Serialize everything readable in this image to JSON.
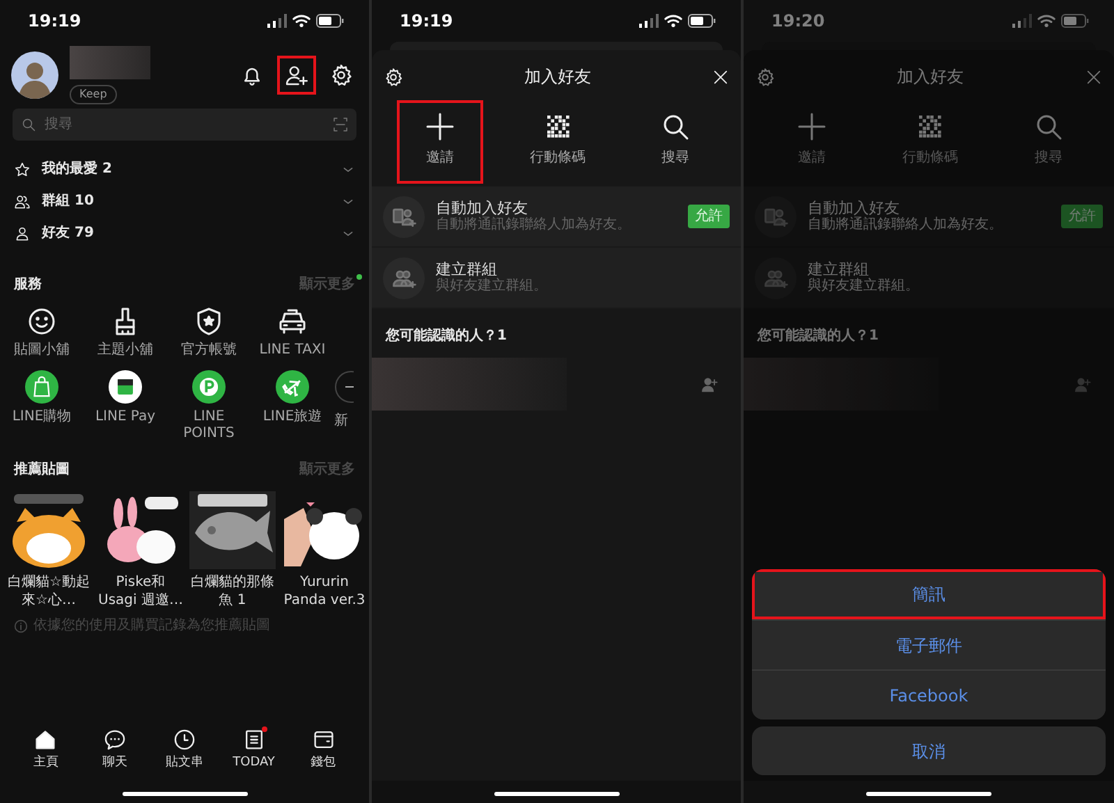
{
  "panels": [
    {
      "kind": "home",
      "status_time": "19:19",
      "profile": {
        "keep_label": "Keep"
      },
      "header_buttons": [
        {
          "highlighted": false
        },
        {
          "highlighted": true
        },
        {
          "highlighted": false
        }
      ],
      "search": {
        "placeholder": "搜尋"
      },
      "groups": [
        {
          "label": "我的最愛 2"
        },
        {
          "label": "群組 10"
        },
        {
          "label": "好友 79"
        }
      ],
      "services": {
        "title": "服務",
        "more": "顯示更多",
        "new_dot": true,
        "items": [
          {
            "label": "貼圖小舖",
            "kind": "outline"
          },
          {
            "label": "主題小舖",
            "kind": "outline"
          },
          {
            "label": "官方帳號",
            "kind": "outline"
          },
          {
            "label": "LINE TAXI",
            "kind": "outline"
          },
          {
            "label": "LINE購物",
            "kind": "green"
          },
          {
            "label": "LINE Pay",
            "kind": "white"
          },
          {
            "label": "LINE POINTS",
            "kind": "green"
          },
          {
            "label": "LINE旅遊",
            "kind": "green"
          },
          {
            "label": "新",
            "kind": "cut"
          }
        ]
      },
      "stickers": {
        "title": "推薦貼圖",
        "more": "顯示更多",
        "items": [
          {
            "name": "白爛貓☆動起來☆心…"
          },
          {
            "name": "Piske和 Usagi 週邀…"
          },
          {
            "name": "白爛貓的那條魚 1"
          },
          {
            "name": "Yururin Panda ver.3"
          }
        ],
        "note": "依據您的使用及購買記錄為您推薦貼圖"
      },
      "tabs": [
        {
          "label": "主頁",
          "selected": true,
          "badge": false
        },
        {
          "label": "聊天",
          "selected": false,
          "badge": false
        },
        {
          "label": "貼文串",
          "selected": false,
          "badge": false
        },
        {
          "label": "TODAY",
          "selected": false,
          "badge": true
        },
        {
          "label": "錢包",
          "selected": false,
          "badge": false
        }
      ]
    },
    {
      "kind": "add_friend",
      "dimmed": false,
      "status_time": "19:19",
      "title": "加入好友",
      "actions": [
        {
          "label": "邀請",
          "highlighted": true
        },
        {
          "label": "行動條碼",
          "highlighted": false
        },
        {
          "label": "搜尋",
          "highlighted": false
        }
      ],
      "rows": [
        {
          "title": "自動加入好友",
          "subtitle": "自動將通訊錄聯絡人加為好友。",
          "button": "允許"
        },
        {
          "title": "建立群組",
          "subtitle": "與好友建立群組。"
        }
      ],
      "section": "您可能認識的人？1"
    },
    {
      "kind": "add_friend",
      "dimmed": true,
      "status_time": "19:20",
      "title": "加入好友",
      "actions": [
        {
          "label": "邀請",
          "highlighted": false
        },
        {
          "label": "行動條碼",
          "highlighted": false
        },
        {
          "label": "搜尋",
          "highlighted": false
        }
      ],
      "rows": [
        {
          "title": "自動加入好友",
          "subtitle": "自動將通訊錄聯絡人加為好友。",
          "button": "允許"
        },
        {
          "title": "建立群組",
          "subtitle": "與好友建立群組。"
        }
      ],
      "section": "您可能認識的人？1",
      "action_sheet": {
        "options": [
          {
            "label": "簡訊",
            "highlighted": true
          },
          {
            "label": "電子郵件",
            "highlighted": false
          },
          {
            "label": "Facebook",
            "highlighted": false
          }
        ],
        "cancel": "取消"
      }
    }
  ]
}
